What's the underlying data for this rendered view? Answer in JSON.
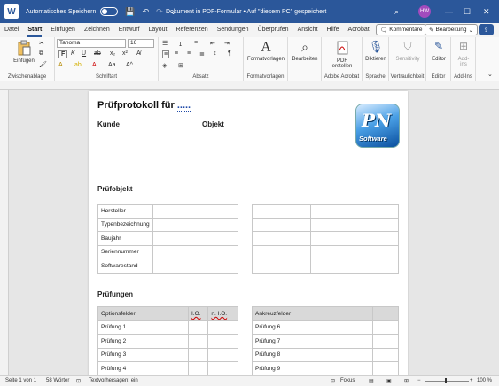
{
  "titlebar": {
    "app_letter": "W",
    "autosave_label": "Automatisches Speichern",
    "doc_title": "Dokument in PDF-Formular • Auf \"diesem PC\" gespeichert",
    "avatar": "HW"
  },
  "tabs": [
    "Datei",
    "Start",
    "Einfügen",
    "Zeichnen",
    "Entwurf",
    "Layout",
    "Referenzen",
    "Sendungen",
    "Überprüfen",
    "Ansicht",
    "Hilfe",
    "Acrobat"
  ],
  "actions": {
    "comments": "Kommentare",
    "editing": "Bearbeitung"
  },
  "ribbon": {
    "paste": "Einfügen",
    "clipboard": "Zwischenablage",
    "font_name": "Tahoma",
    "font_size": "16",
    "font": "Schriftart",
    "paragraph": "Absatz",
    "styles_btn": "Formatvorlagen",
    "styles_group": "Formatvorlagen",
    "editing_btn": "Bearbeiten",
    "pdf_btn_1": "PDF",
    "pdf_btn_2": "erstellen",
    "acrobat_group": "Adobe Acrobat",
    "dictate_btn": "Diktieren",
    "speech_group": "Sprache",
    "sensitivity_btn": "Sensitivity",
    "confidentiality_group": "Vertraulichkeit",
    "editor_btn": "Editor",
    "editor_group": "Editor",
    "addins_btn_1": "Add-",
    "addins_btn_2": "ins",
    "addins_group": "Add-Ins"
  },
  "document": {
    "title": "Prüfprotokoll für ",
    "title_dots": ".....",
    "kunde": "Kunde",
    "objekt": "Objekt",
    "logo_text": "PN",
    "logo_sub": "Software",
    "section1": "Prüfobjekt",
    "left_fields": [
      "Hersteller",
      "Typenbezeichnung",
      "Baujahr",
      "Seriennummer",
      "Softwarestand"
    ],
    "section2": "Prüfungen",
    "options_header": [
      "Optionsfelder",
      "I.O.",
      "n. I.O."
    ],
    "options_rows": [
      "Prüfung 1",
      "Prüfung 2",
      "Prüfung 3",
      "Prüfung 4"
    ],
    "check_header": "Ankreuzfelder",
    "check_rows": [
      "Prüfung 6",
      "Prüfung 7",
      "Prüfung 8",
      "Prüfung 9"
    ]
  },
  "status": {
    "page": "Seite 1 von 1",
    "words": "58 Wörter",
    "prediction": "Textvorhersagen: ein",
    "focus": "Fokus",
    "zoom": "100 %"
  }
}
